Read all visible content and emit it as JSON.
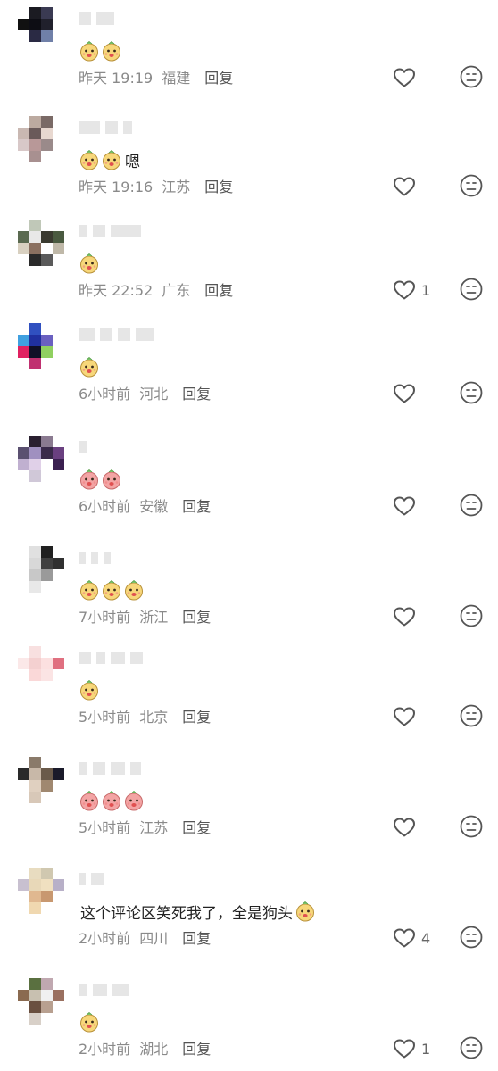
{
  "comments": [
    {
      "emojis": [
        "yellow",
        "yellow"
      ],
      "text": "",
      "time": "昨天 19:19",
      "location": "福建",
      "reply": "回复",
      "likes": "",
      "avatar": [
        "#fff",
        "#1b1b22",
        "#3a3a52",
        "#fff",
        "#111",
        "#0d0d14",
        "#20202c",
        "#fff",
        "#fff",
        "#2a2a44",
        "#7080a8",
        "#fff",
        "#fff",
        "#fff",
        "#fff",
        "#fff"
      ]
    },
    {
      "emojis": [
        "yellow",
        "yellow"
      ],
      "text": "嗯",
      "time": "昨天 19:16",
      "location": "江苏",
      "reply": "回复",
      "likes": "",
      "avatar": [
        "#fff",
        "#bcaaa0",
        "#7a6a66",
        "#fff",
        "#c9b8b2",
        "#6a5a5a",
        "#e8d8d0",
        "#fff",
        "#d8c8c8",
        "#b89898",
        "#9a8a8a",
        "#fff",
        "#fff",
        "#a89090",
        "#fff",
        "#fff"
      ]
    },
    {
      "emojis": [
        "yellow"
      ],
      "text": "",
      "time": "昨天 22:52",
      "location": "广东",
      "reply": "回复",
      "likes": "1",
      "avatar": [
        "#fff",
        "#c0c8b8",
        "#fff",
        "#fff",
        "#5a6a50",
        "#e8e8e8",
        "#3a3a30",
        "#4a5a40",
        "#d8d0c0",
        "#8a7060",
        "#fff",
        "#bfb8a8",
        "#fff",
        "#2a2a2a",
        "#5a5a5a",
        "#fff"
      ]
    },
    {
      "emojis": [
        "yellow"
      ],
      "text": "",
      "time": "6小时前",
      "location": "河北",
      "reply": "回复",
      "likes": "",
      "avatar": [
        "#fff",
        "#3050c0",
        "#fff",
        "#fff",
        "#40a0e0",
        "#2030a0",
        "#6a60c0",
        "#fff",
        "#e02060",
        "#101028",
        "#90d060",
        "#fff",
        "#fff",
        "#c03070",
        "#fff",
        "#fff"
      ]
    },
    {
      "emojis": [
        "pink",
        "pink"
      ],
      "text": "",
      "time": "6小时前",
      "location": "安徽",
      "reply": "回复",
      "likes": "",
      "avatar": [
        "#fff",
        "#2a2030",
        "#8a7a90",
        "#fff",
        "#5a5070",
        "#a090c0",
        "#3a2a4a",
        "#6a4080",
        "#c0b0d0",
        "#e0d0e8",
        "#fff",
        "#3a2050",
        "#fff",
        "#d0c8d8",
        "#fff",
        "#fff"
      ]
    },
    {
      "emojis": [
        "yellow",
        "yellow",
        "yellow"
      ],
      "text": "",
      "time": "7小时前",
      "location": "浙江",
      "reply": "回复",
      "likes": "",
      "avatar": [
        "#fff",
        "#e0e0e0",
        "#202020",
        "#fff",
        "#fff",
        "#d8d8d8",
        "#404040",
        "#303030",
        "#fff",
        "#c8c8c8",
        "#9a9a9a",
        "#fff",
        "#fff",
        "#e8e8e8",
        "#fff",
        "#fff"
      ]
    },
    {
      "emojis": [
        "yellow"
      ],
      "text": "",
      "time": "5小时前",
      "location": "北京",
      "reply": "回复",
      "likes": "",
      "avatar": [
        "#fff",
        "#f8e0e0",
        "#fff",
        "#fff",
        "#fbe8e8",
        "#f4d0d0",
        "#fce0e0",
        "#e07080",
        "#fff",
        "#fad8d8",
        "#fbe4e4",
        "#fff",
        "#fff",
        "#fff",
        "#fff",
        "#fff"
      ]
    },
    {
      "emojis": [
        "pink",
        "pink",
        "pink"
      ],
      "text": "",
      "time": "5小时前",
      "location": "江苏",
      "reply": "回复",
      "likes": "",
      "avatar": [
        "#fff",
        "#8a7a6a",
        "#fff",
        "#fff",
        "#2a2a2a",
        "#c8b8a8",
        "#6a5a4a",
        "#1a1a2a",
        "#fff",
        "#e0d0c0",
        "#a08870",
        "#fff",
        "#fff",
        "#d8c8b8",
        "#fff",
        "#fff"
      ]
    },
    {
      "emojis": [],
      "text": "这个评论区笑死我了，全是狗头",
      "trailing_emoji": "yellow",
      "time": "2小时前",
      "location": "四川",
      "reply": "回复",
      "likes": "4",
      "avatar": [
        "#fff",
        "#e8dcc0",
        "#d0c8b0",
        "#fff",
        "#c8c0d0",
        "#e8d8b8",
        "#f0e0c0",
        "#b8b0c8",
        "#fff",
        "#e0b890",
        "#c89870",
        "#fff",
        "#fff",
        "#f0d8b0",
        "#fff",
        "#fff"
      ]
    },
    {
      "emojis": [
        "yellow"
      ],
      "text": "",
      "time": "2小时前",
      "location": "湖北",
      "reply": "回复",
      "likes": "1",
      "avatar": [
        "#fff",
        "#5a7040",
        "#c0a8b0",
        "#fff",
        "#8a6a50",
        "#c8c0b0",
        "#f0f0f0",
        "#9a7060",
        "#fff",
        "#6a5040",
        "#b8a090",
        "#fff",
        "#fff",
        "#d8d0c8",
        "#fff",
        "#fff"
      ]
    }
  ],
  "name_bar_patterns": [
    [
      14,
      20
    ],
    [
      24,
      14,
      10
    ],
    [
      10,
      14,
      34
    ],
    [
      18,
      14,
      14,
      20
    ],
    [
      10
    ],
    [
      8,
      8,
      8
    ],
    [
      14,
      10,
      16,
      14
    ],
    [
      10,
      14,
      16,
      12
    ],
    [
      8,
      14
    ],
    [
      10,
      16,
      18
    ]
  ]
}
